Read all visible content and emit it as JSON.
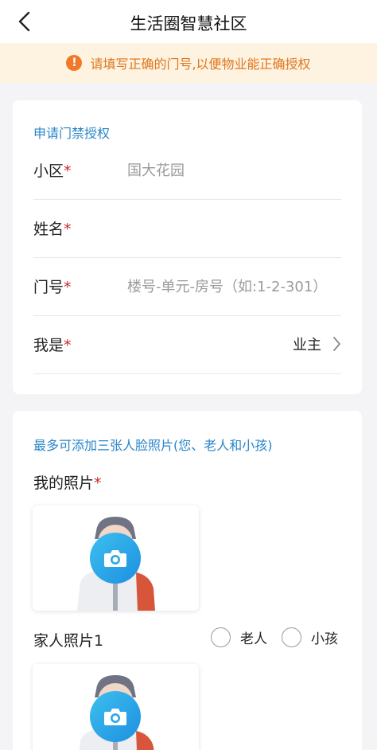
{
  "header": {
    "title": "生活圈智慧社区"
  },
  "notice": {
    "text": "请填写正确的门号,以便物业能正确授权"
  },
  "access_form": {
    "section_title": "申请门禁授权",
    "fields": {
      "community": {
        "label": "小区",
        "required_mark": "*",
        "value": "国大花园"
      },
      "name": {
        "label": "姓名",
        "required_mark": "*",
        "value": ""
      },
      "door": {
        "label": "门号",
        "required_mark": "*",
        "placeholder": "楼号-单元-房号（如:1-2-301）"
      },
      "identity": {
        "label": "我是",
        "required_mark": "*",
        "value": "业主"
      }
    }
  },
  "photos": {
    "section_title": "最多可添加三张人脸照片(您、老人和小孩)",
    "my_photo": {
      "label": "我的照片",
      "required_mark": "*"
    },
    "family_photo_1": {
      "label": "家人照片1",
      "options": [
        "老人",
        "小孩"
      ]
    }
  },
  "colors": {
    "accent": "#2a86c8",
    "notice_bg": "#fdf3e0",
    "notice_text": "#e0761f",
    "required": "#c92a2a",
    "camera_gradient_start": "#3cc0ef",
    "camera_gradient_end": "#1e8fe0"
  },
  "icons": {
    "back": "chevron-left-icon",
    "notice": "exclamation-circle-icon",
    "disclosure": "chevron-right-icon",
    "camera": "camera-icon"
  }
}
